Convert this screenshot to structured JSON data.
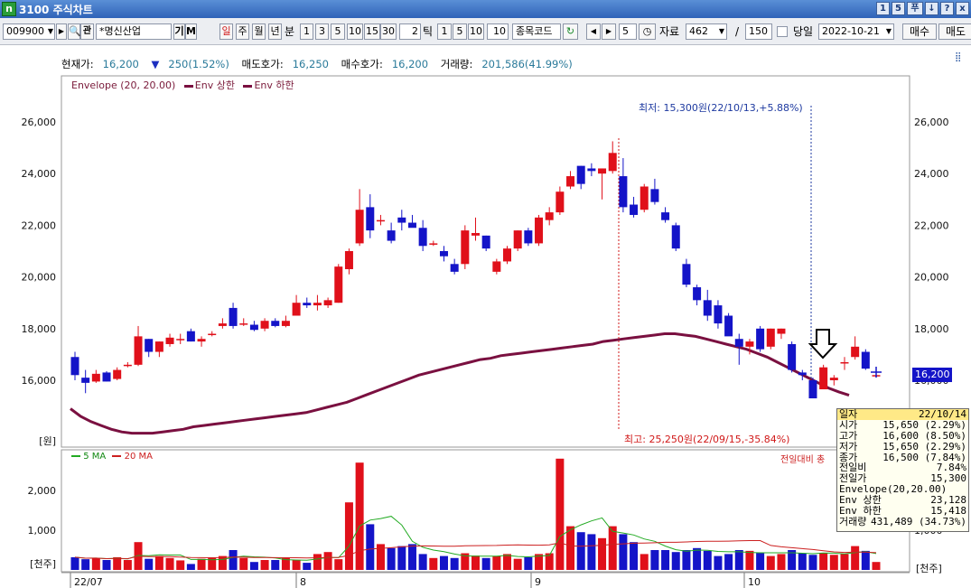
{
  "window": {
    "title": "3100 주식차트",
    "app_icon": "n",
    "buttons": [
      "1",
      "5",
      "푸",
      "↓",
      "?",
      "x"
    ]
  },
  "toolbar": {
    "code": "009900",
    "company": "*명신산업",
    "btn_gi": "기",
    "btn_m": "M",
    "period_il": "일",
    "period_ju": "주",
    "period_wol": "월",
    "period_nyeon": "년",
    "period_bun": "분",
    "min_options": [
      "1",
      "3",
      "5",
      "10",
      "15",
      "30"
    ],
    "tick_value": "2",
    "tick_label": "틱",
    "tick_options": [
      "1",
      "5",
      "10"
    ],
    "tick_input": "10",
    "code_box": "종목코드",
    "nav_count": "5",
    "data_label": "자료",
    "data_count": "462",
    "slash": "/",
    "view_count": "150",
    "today_label": "당일",
    "date": "2022-10-21",
    "buy_label": "매수",
    "sell_label": "매도"
  },
  "info": {
    "price_label": "현재가:",
    "price": "16,200",
    "change_arrow": "▼",
    "change": "250(1.52%)",
    "ask_label": "매도호가:",
    "ask": "16,250",
    "bid_label": "매수호가:",
    "bid": "16,200",
    "vol_label": "거래량:",
    "vol": "201,586(41.99%)"
  },
  "legend": {
    "env": "Envelope (20, 20.00)",
    "upper": "Env 상한",
    "lower": "Env 하한",
    "ma5": "5 MA",
    "ma20": "20 MA",
    "prev_ratio": "전일대비 ",
    "prev_ratio_tail": "총"
  },
  "annotations": {
    "low": "최저: 15,300원(22/10/13,+5.88%)",
    "high": "최고: 25,250원(22/09/15,-35.84%)",
    "price_tag": "16,200"
  },
  "axes": {
    "price_ticks": [
      "26,000",
      "24,000",
      "22,000",
      "20,000",
      "18,000",
      "16,000"
    ],
    "price_unit": "[원]",
    "vol_ticks": [
      "2,000",
      "1,000"
    ],
    "vol_unit": "[천주]",
    "x_ticks": [
      "22/07",
      "8",
      "9",
      "10"
    ]
  },
  "popup": [
    [
      "일자",
      "22/10/14"
    ],
    [
      "시가",
      "15,650  (2.29%)"
    ],
    [
      "고가",
      "16,600  (8.50%)"
    ],
    [
      "저가",
      "15,650  (2.29%)"
    ],
    [
      "종가",
      "16,500  (7.84%)"
    ],
    [
      "전일비",
      "7.84%"
    ],
    [
      "전일가",
      "15,300"
    ],
    [
      "Envelope(20,20.00)",
      ""
    ],
    [
      "Env 상한",
      "23,128"
    ],
    [
      "Env 하한",
      "15,418"
    ],
    [
      "거래량",
      "431,489 (34.73%)"
    ]
  ],
  "colors": {
    "up": "#e0101a",
    "down": "#1414c8",
    "env": "#7a1040",
    "ma5": "#22aa22",
    "ma20": "#cc2020"
  },
  "chart_data": {
    "type": "candlestick",
    "price_ylim": [
      15000,
      27000
    ],
    "volume_ylim": [
      0,
      3000
    ],
    "candles": [
      {
        "o": 16900,
        "h": 17100,
        "l": 16000,
        "c": 16200
      },
      {
        "o": 16100,
        "h": 16400,
        "l": 15500,
        "c": 15900
      },
      {
        "o": 15950,
        "h": 16400,
        "l": 15900,
        "c": 16250
      },
      {
        "o": 16300,
        "h": 16350,
        "l": 15950,
        "c": 15950
      },
      {
        "o": 16050,
        "h": 16500,
        "l": 16000,
        "c": 16400
      },
      {
        "o": 16550,
        "h": 16700,
        "l": 16500,
        "c": 16600
      },
      {
        "o": 16600,
        "h": 18100,
        "l": 16550,
        "c": 17700
      },
      {
        "o": 17600,
        "h": 17600,
        "l": 16900,
        "c": 17100
      },
      {
        "o": 17100,
        "h": 17500,
        "l": 16900,
        "c": 17500
      },
      {
        "o": 17400,
        "h": 17800,
        "l": 17300,
        "c": 17650
      },
      {
        "o": 17600,
        "h": 17800,
        "l": 17400,
        "c": 17600
      },
      {
        "o": 17900,
        "h": 18000,
        "l": 17500,
        "c": 17500
      },
      {
        "o": 17500,
        "h": 17700,
        "l": 17300,
        "c": 17600
      },
      {
        "o": 17800,
        "h": 17900,
        "l": 17700,
        "c": 17800
      },
      {
        "o": 18100,
        "h": 18400,
        "l": 18000,
        "c": 18200
      },
      {
        "o": 18800,
        "h": 19000,
        "l": 18000,
        "c": 18100
      },
      {
        "o": 18200,
        "h": 18400,
        "l": 18100,
        "c": 18200
      },
      {
        "o": 18150,
        "h": 18300,
        "l": 17900,
        "c": 17950
      },
      {
        "o": 18000,
        "h": 18400,
        "l": 17900,
        "c": 18300
      },
      {
        "o": 18300,
        "h": 18400,
        "l": 18050,
        "c": 18100
      },
      {
        "o": 18100,
        "h": 18500,
        "l": 18050,
        "c": 18300
      },
      {
        "o": 18500,
        "h": 19300,
        "l": 18500,
        "c": 19000
      },
      {
        "o": 19000,
        "h": 19200,
        "l": 18800,
        "c": 18900
      },
      {
        "o": 18900,
        "h": 19300,
        "l": 18700,
        "c": 19000
      },
      {
        "o": 18900,
        "h": 19200,
        "l": 18800,
        "c": 19100
      },
      {
        "o": 19000,
        "h": 20500,
        "l": 19000,
        "c": 20400
      },
      {
        "o": 20300,
        "h": 21100,
        "l": 20100,
        "c": 21000
      },
      {
        "o": 21300,
        "h": 23400,
        "l": 21200,
        "c": 22600
      },
      {
        "o": 22700,
        "h": 23200,
        "l": 21500,
        "c": 21800
      },
      {
        "o": 22200,
        "h": 22400,
        "l": 22000,
        "c": 22200
      },
      {
        "o": 21800,
        "h": 22100,
        "l": 21300,
        "c": 21400
      },
      {
        "o": 22300,
        "h": 22600,
        "l": 21800,
        "c": 22100
      },
      {
        "o": 22100,
        "h": 22400,
        "l": 22000,
        "c": 21900
      },
      {
        "o": 21900,
        "h": 22200,
        "l": 21000,
        "c": 21200
      },
      {
        "o": 21300,
        "h": 21400,
        "l": 21200,
        "c": 21300
      },
      {
        "o": 21000,
        "h": 21200,
        "l": 20600,
        "c": 20800
      },
      {
        "o": 20500,
        "h": 20700,
        "l": 20100,
        "c": 20200
      },
      {
        "o": 20500,
        "h": 22000,
        "l": 20300,
        "c": 21800
      },
      {
        "o": 21600,
        "h": 22300,
        "l": 21400,
        "c": 21700
      },
      {
        "o": 21600,
        "h": 21600,
        "l": 21000,
        "c": 21100
      },
      {
        "o": 20200,
        "h": 20700,
        "l": 20100,
        "c": 20600
      },
      {
        "o": 20600,
        "h": 21200,
        "l": 20500,
        "c": 21100
      },
      {
        "o": 21100,
        "h": 21800,
        "l": 21000,
        "c": 21800
      },
      {
        "o": 21800,
        "h": 21900,
        "l": 21200,
        "c": 21300
      },
      {
        "o": 21300,
        "h": 22400,
        "l": 21200,
        "c": 22300
      },
      {
        "o": 22200,
        "h": 22700,
        "l": 22000,
        "c": 22500
      },
      {
        "o": 22500,
        "h": 23500,
        "l": 22400,
        "c": 23300
      },
      {
        "o": 23500,
        "h": 24100,
        "l": 23400,
        "c": 23900
      },
      {
        "o": 24300,
        "h": 24300,
        "l": 23400,
        "c": 23600
      },
      {
        "o": 24200,
        "h": 24400,
        "l": 23900,
        "c": 24100
      },
      {
        "o": 24000,
        "h": 24200,
        "l": 23000,
        "c": 24200
      },
      {
        "o": 24100,
        "h": 25250,
        "l": 24000,
        "c": 24800
      },
      {
        "o": 23900,
        "h": 24600,
        "l": 22500,
        "c": 22700
      },
      {
        "o": 22800,
        "h": 23100,
        "l": 22300,
        "c": 22400
      },
      {
        "o": 22600,
        "h": 23600,
        "l": 22500,
        "c": 23500
      },
      {
        "o": 23400,
        "h": 23800,
        "l": 22800,
        "c": 22900
      },
      {
        "o": 22500,
        "h": 22700,
        "l": 22100,
        "c": 22200
      },
      {
        "o": 22000,
        "h": 22100,
        "l": 21000,
        "c": 21100
      },
      {
        "o": 20500,
        "h": 20700,
        "l": 19600,
        "c": 19700
      },
      {
        "o": 19600,
        "h": 19700,
        "l": 18900,
        "c": 19100
      },
      {
        "o": 19100,
        "h": 19500,
        "l": 18300,
        "c": 18500
      },
      {
        "o": 18900,
        "h": 19100,
        "l": 18000,
        "c": 18200
      },
      {
        "o": 18500,
        "h": 18600,
        "l": 17800,
        "c": 17700
      },
      {
        "o": 17600,
        "h": 17800,
        "l": 16600,
        "c": 17300
      },
      {
        "o": 17300,
        "h": 17600,
        "l": 17000,
        "c": 17500
      },
      {
        "o": 18000,
        "h": 18100,
        "l": 17100,
        "c": 17200
      },
      {
        "o": 17300,
        "h": 18000,
        "l": 17200,
        "c": 18000
      },
      {
        "o": 17800,
        "h": 18000,
        "l": 17600,
        "c": 18000
      },
      {
        "o": 17400,
        "h": 17500,
        "l": 16300,
        "c": 16400
      },
      {
        "o": 16300,
        "h": 16400,
        "l": 16000,
        "c": 16200
      },
      {
        "o": 16000,
        "h": 16100,
        "l": 15300,
        "c": 15300
      },
      {
        "o": 15650,
        "h": 16600,
        "l": 15650,
        "c": 16500
      },
      {
        "o": 16000,
        "h": 16200,
        "l": 15800,
        "c": 16100
      },
      {
        "o": 16700,
        "h": 16900,
        "l": 16400,
        "c": 16700
      },
      {
        "o": 16900,
        "h": 17700,
        "l": 16800,
        "c": 17300
      },
      {
        "o": 17100,
        "h": 17200,
        "l": 16400,
        "c": 16450
      },
      {
        "o": 16200,
        "h": 16400,
        "l": 16100,
        "c": 16200
      }
    ],
    "volumes": [
      320,
      270,
      300,
      250,
      320,
      250,
      700,
      280,
      350,
      300,
      240,
      150,
      280,
      300,
      350,
      500,
      300,
      200,
      250,
      250,
      300,
      250,
      180,
      400,
      450,
      270,
      1700,
      2700,
      1150,
      650,
      550,
      600,
      650,
      400,
      300,
      350,
      300,
      420,
      360,
      300,
      350,
      400,
      280,
      320,
      400,
      420,
      2800,
      1100,
      950,
      900,
      800,
      1100,
      900,
      700,
      400,
      500,
      500,
      450,
      500,
      550,
      480,
      350,
      400,
      500,
      480,
      430,
      350,
      400,
      500,
      420,
      380,
      431,
      380,
      400,
      600,
      480,
      200
    ],
    "env_lower": [
      14900,
      14600,
      14400,
      14250,
      14100,
      14000,
      13950,
      13950,
      13950,
      14000,
      14050,
      14100,
      14200,
      14250,
      14300,
      14350,
      14400,
      14450,
      14500,
      14550,
      14600,
      14650,
      14700,
      14750,
      14850,
      14950,
      15050,
      15150,
      15300,
      15450,
      15600,
      15750,
      15900,
      16050,
      16200,
      16300,
      16400,
      16500,
      16600,
      16700,
      16800,
      16850,
      16950,
      17000,
      17050,
      17100,
      17150,
      17200,
      17250,
      17300,
      17350,
      17400,
      17500,
      17550,
      17600,
      17650,
      17700,
      17750,
      17800,
      17800,
      17750,
      17700,
      17600,
      17500,
      17400,
      17300,
      17200,
      17050,
      16900,
      16700,
      16500,
      16300,
      16100,
      15900,
      15700,
      15550,
      15418
    ]
  }
}
